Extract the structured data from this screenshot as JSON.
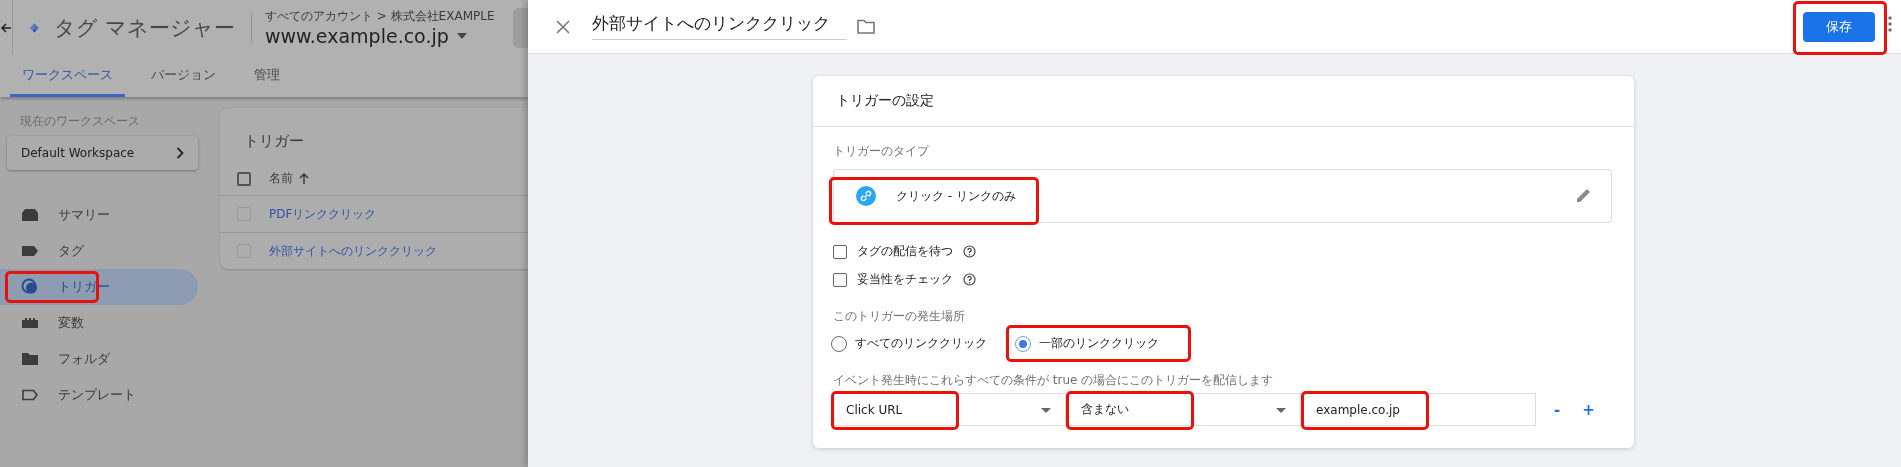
{
  "app_bar": {
    "title": "タグ マネージャー",
    "breadcrumb": "すべてのアカウント > 株式会社EXAMPLE",
    "container": "www.example.co.jp"
  },
  "nav_tabs": [
    {
      "label": "ワークスペース",
      "selected": true
    },
    {
      "label": "バージョン",
      "selected": false
    },
    {
      "label": "管理",
      "selected": false
    }
  ],
  "workspace": {
    "label": "現在のワークスペース",
    "name": "Default Workspace"
  },
  "sidebar": {
    "items": [
      {
        "label": "サマリー",
        "kind": "summary",
        "selected": false,
        "highlighted": false
      },
      {
        "label": "タグ",
        "kind": "tag",
        "selected": false,
        "highlighted": false
      },
      {
        "label": "トリガー",
        "kind": "trigger",
        "selected": true,
        "highlighted": true
      },
      {
        "label": "変数",
        "kind": "variable",
        "selected": false,
        "highlighted": false
      },
      {
        "label": "フォルダ",
        "kind": "folder",
        "selected": false,
        "highlighted": false
      },
      {
        "label": "テンプレート",
        "kind": "template",
        "selected": false,
        "highlighted": false
      }
    ]
  },
  "trigger_list": {
    "title": "トリガー",
    "column": "名前",
    "header_checked": false,
    "rows": [
      {
        "name": "PDFリンククリック",
        "checked": false
      },
      {
        "name": "外部サイトへのリンククリック",
        "checked": false
      }
    ]
  },
  "panel": {
    "title": "外部サイトへのリンククリック",
    "save_button": {
      "label": "保存",
      "highlighted": true
    }
  },
  "card": {
    "title": "トリガーの設定",
    "type_label": "トリガーのタイプ",
    "type": {
      "name": "クリック - リンクのみ",
      "highlighted": true
    },
    "options": [
      {
        "label": "タグの配信を待つ",
        "checked": false
      },
      {
        "label": "妥当性をチェック",
        "checked": false
      }
    ],
    "scope_label": "このトリガーの発生場所",
    "scope_options": [
      {
        "label": "すべてのリンククリック",
        "selected": false,
        "highlighted": false
      },
      {
        "label": "一部のリンククリック",
        "selected": true,
        "highlighted": true
      }
    ],
    "condition_label": "イベント発生時にこれらすべての条件が true の場合にこのトリガーを配信します",
    "condition": {
      "fields": [
        {
          "kind": "dropdown",
          "value": "Click URL",
          "highlighted": true
        },
        {
          "kind": "dropdown",
          "value": "含まない",
          "highlighted": true
        },
        {
          "kind": "text",
          "value": "example.co.jp",
          "highlighted": true
        }
      ],
      "remove": "-",
      "add": "+"
    }
  }
}
